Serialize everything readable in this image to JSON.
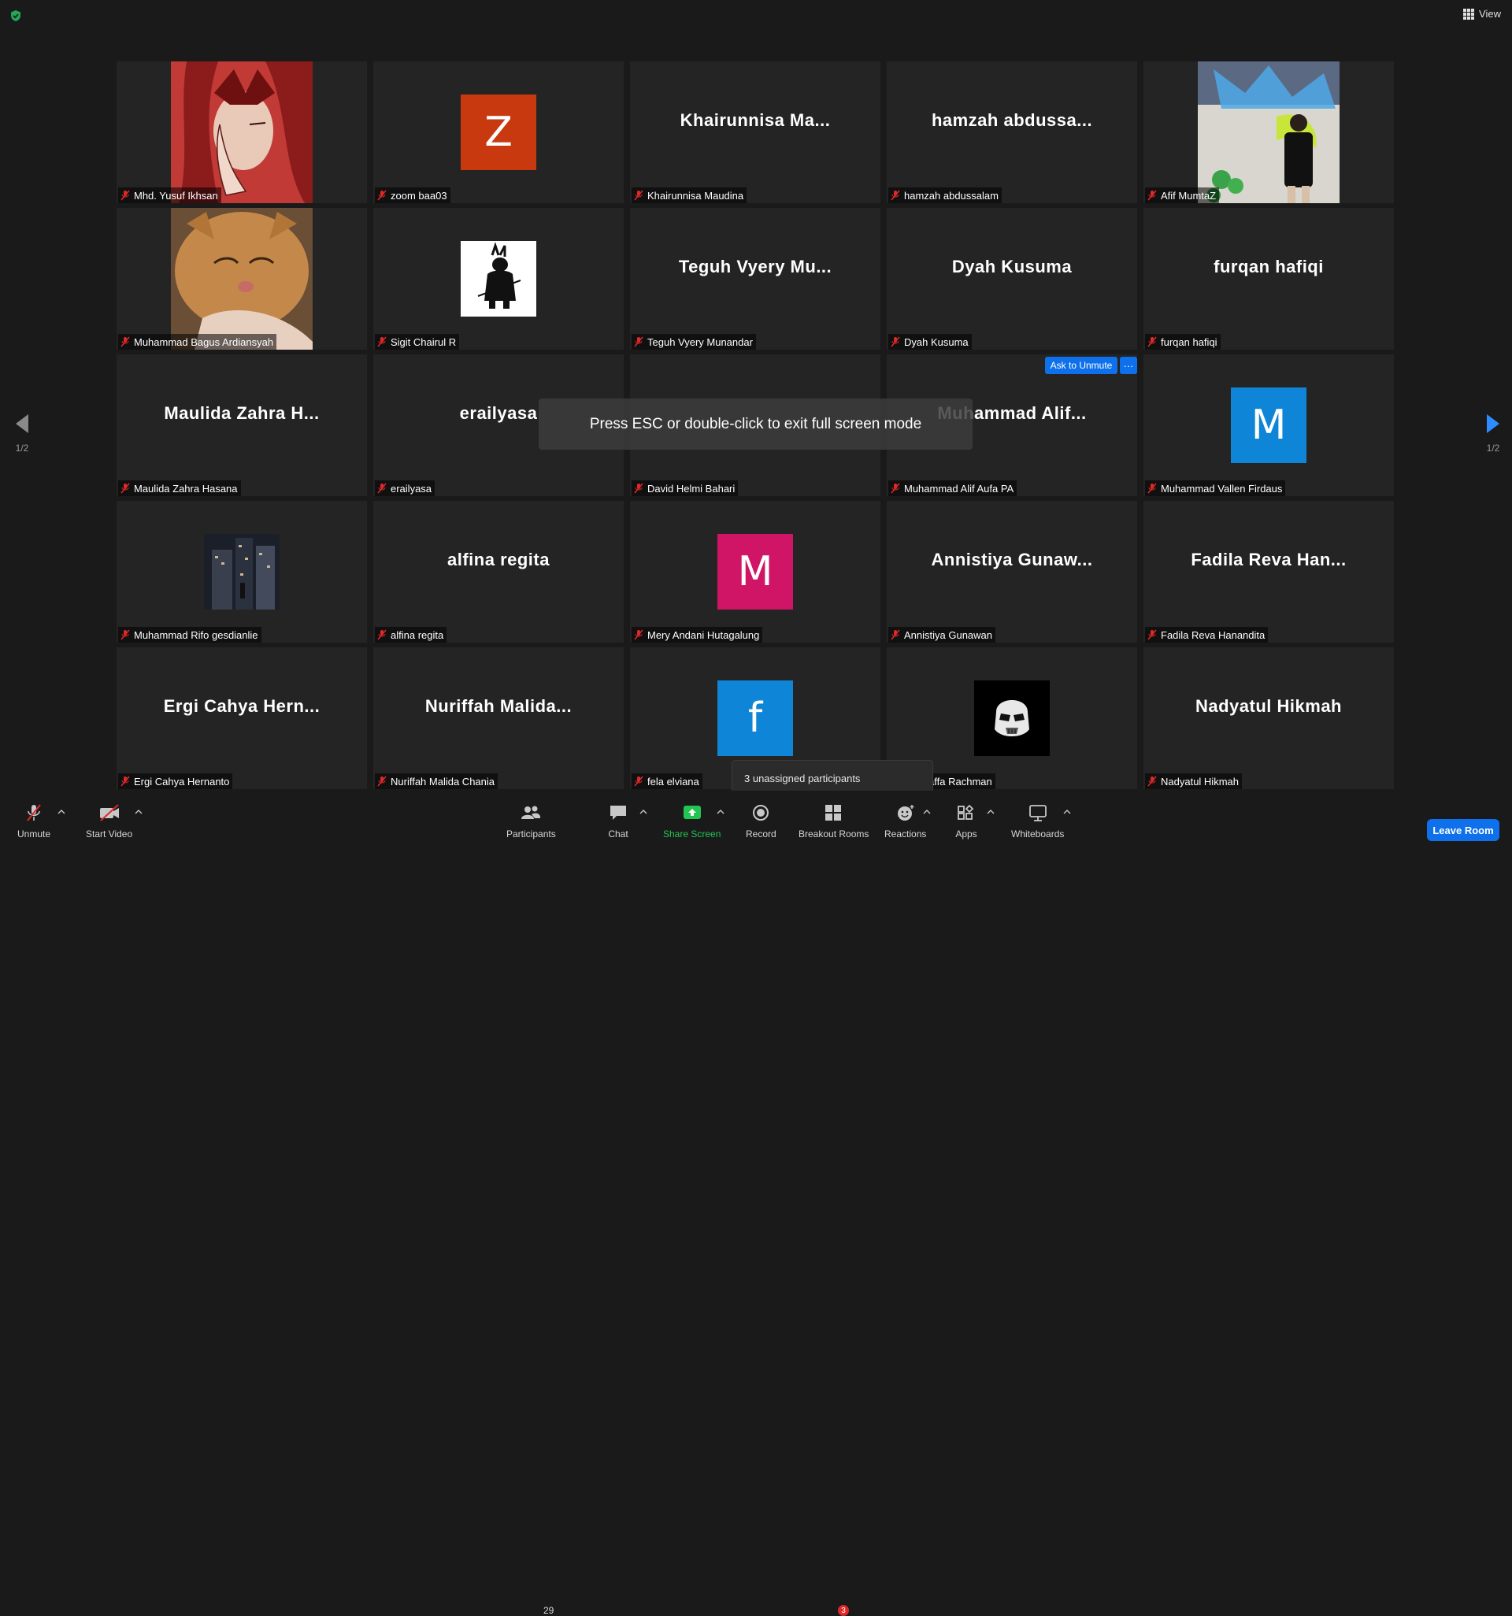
{
  "top": {
    "view_label": "View"
  },
  "nav": {
    "prev_page": "1/2",
    "next_page": "1/2"
  },
  "overlay": {
    "fullscreen_tip": "Press ESC or double-click to exit full screen mode",
    "ask_to_unmute": "Ask to Unmute",
    "more": "···",
    "popup": "3 unassigned participants"
  },
  "tiles": [
    {
      "label": "Mhd. Yusuf Ikhsan"
    },
    {
      "label": "zoom baa03",
      "avatar": "Z",
      "avatar_color": "#c9390f"
    },
    {
      "label": "Khairunnisa Maudina",
      "big": "Khairunnisa  Ma..."
    },
    {
      "label": "hamzah abdussalam",
      "big": "hamzah  abdussa..."
    },
    {
      "label": "Afif MumtaZ"
    },
    {
      "label": "Muhammad Bagus Ardiansyah"
    },
    {
      "label": "Sigit Chairul R"
    },
    {
      "label": "Teguh Vyery Munandar",
      "big": "Teguh  Vyery  Mu..."
    },
    {
      "label": "Dyah Kusuma",
      "big": "Dyah Kusuma"
    },
    {
      "label": "furqan hafiqi",
      "big": "furqan  hafiqi"
    },
    {
      "label": "Maulida Zahra Hasana",
      "big": "Maulida  Zahra  H..."
    },
    {
      "label": "erailyasa",
      "big": "erailyasa"
    },
    {
      "label": "David Helmi Bahari"
    },
    {
      "label": "Muhammad Alif Aufa PA",
      "big": "Muhammad  Alif..."
    },
    {
      "label": "Muhammad Vallen Firdaus",
      "avatar": "M",
      "avatar_color": "#0e85d6"
    },
    {
      "label": "Muhammad Rifo gesdianlie"
    },
    {
      "label": "alfina regita",
      "big": "alfina  regita"
    },
    {
      "label": "Mery Andani Hutagalung",
      "avatar": "M",
      "avatar_color": "#d11566"
    },
    {
      "label": "Annistiya Gunawan",
      "big": "Annistiya  Gunaw..."
    },
    {
      "label": "Fadila Reva Hanandita",
      "big": "Fadila  Reva  Han..."
    },
    {
      "label": "Ergi Cahya Hernanto",
      "big": "Ergi  Cahya  Hern..."
    },
    {
      "label": "Nuriffah Malida Chania",
      "big": "Nuriffah  Malida..."
    },
    {
      "label": "fela elviana",
      "avatar": "f",
      "avatar_color": "#0e85d6"
    },
    {
      "label": "Musyaffa Rachman"
    },
    {
      "label": "Nadyatul Hikmah",
      "big": "Nadyatul Hikmah"
    }
  ],
  "toolbar": {
    "unmute": "Unmute",
    "start_video": "Start Video",
    "participants": "Participants",
    "participants_count": "29",
    "chat": "Chat",
    "share_screen": "Share Screen",
    "record": "Record",
    "breakout_rooms": "Breakout Rooms",
    "breakout_badge": "3",
    "reactions": "Reactions",
    "apps": "Apps",
    "whiteboards": "Whiteboards",
    "leave_room": "Leave Room"
  }
}
